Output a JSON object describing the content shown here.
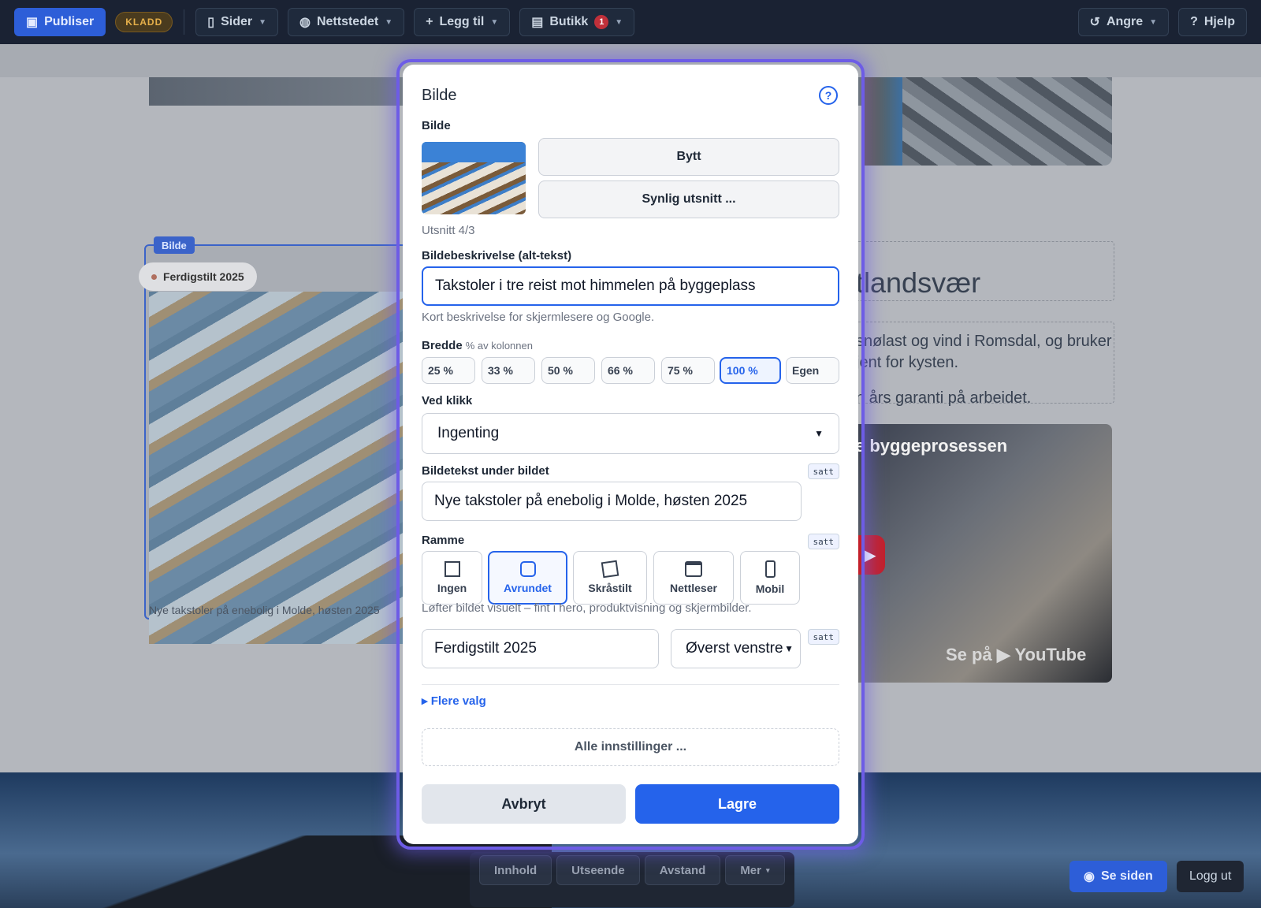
{
  "topbar": {
    "publish_label": "Publiser",
    "draft_badge": "KLADD",
    "pages_label": "Sider",
    "site_label": "Nettstedet",
    "add_label": "Legg til",
    "shop_label": "Butikk",
    "shop_count": "1",
    "undo_label": "Angre",
    "help_label": "Hjelp"
  },
  "canvas": {
    "image_block_tag": "Bilde",
    "image_pill": "Ferdigstilt 2025",
    "image_caption": "Nye takstoler på enebolig i Molde, høsten 2025",
    "heading_fragment": "tlandsvær",
    "para_line1": "snølast og vind i Romsdal, og bruker",
    "para_line2": "jent for kysten.",
    "para_line3": "n års garanti på arbeidet.",
    "video_title": "e byggeprosessen",
    "video_watch": "Se på",
    "video_brand": "YouTube"
  },
  "bottom_tabs": [
    "Innhold",
    "Utseende",
    "Avstand",
    "Mer"
  ],
  "view_site_label": "Se siden",
  "logout_label": "Logg ut",
  "modal": {
    "title": "Bilde",
    "image_section_label": "Bilde",
    "replace_button": "Bytt",
    "crop_button": "Synlig utsnitt ...",
    "crop_hint": "Utsnitt 4/3",
    "alt_label": "Bildebeskrivelse (alt-tekst)",
    "alt_value": "Takstoler i tre reist mot himmelen på byggeplass",
    "alt_hint": "Kort beskrivelse for skjermlesere og Google.",
    "width_label": "Bredde",
    "width_sublabel": "% av kolonnen",
    "width_options": [
      "25 %",
      "33 %",
      "50 %",
      "66 %",
      "75 %",
      "100 %",
      "Egen"
    ],
    "width_selected": "100 %",
    "click_label": "Ved klikk",
    "click_value": "Ingenting",
    "caption_label": "Bildetekst under bildet",
    "caption_value": "Nye takstoler på enebolig i Molde, høsten 2025",
    "set_tag": "satt",
    "frame_label": "Ramme",
    "frame_options": [
      "Ingen",
      "Avrundet",
      "Skråstilt",
      "Nettleser",
      "Mobil"
    ],
    "frame_selected": "Avrundet",
    "frame_hint": "Løfter bildet visuelt – fint i hero, produktvisning og skjermbilder.",
    "badge_value": "Ferdigstilt 2025",
    "badge_position": "Øverst venstre",
    "more_options": "▸ Flere valg",
    "all_settings": "Alle innstillinger ...",
    "cancel": "Avbryt",
    "save": "Lagre"
  },
  "colors": {
    "accent": "#2563eb",
    "modal_glow": "#6d5ce6",
    "topbar": "#1a2233"
  }
}
